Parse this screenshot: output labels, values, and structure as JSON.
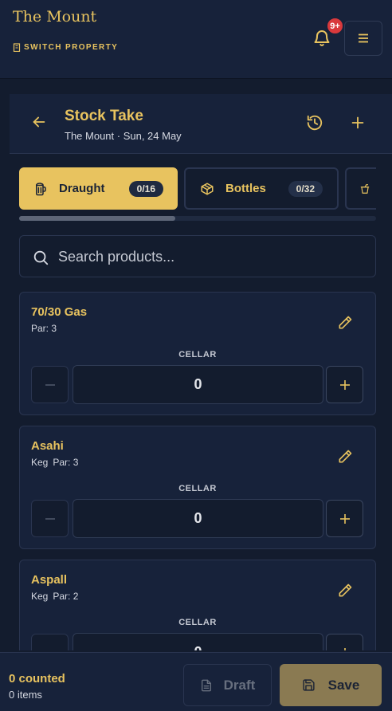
{
  "colors": {
    "accent": "#e8c35f",
    "background": "#131c2e",
    "panel": "#17223a",
    "badge": "#d9393c"
  },
  "header": {
    "brand": "The Mount",
    "switch_property": "SWITCH PROPERTY",
    "notification_badge": "9+"
  },
  "page": {
    "title": "Stock Take",
    "subtitle": "The Mount · Sun, 24 May"
  },
  "tabs": [
    {
      "label": "Draught",
      "count": "0/16",
      "icon": "beer-glass-icon",
      "active": true
    },
    {
      "label": "Bottles",
      "count": "0/32",
      "icon": "box-icon",
      "active": false
    },
    {
      "label": "",
      "count": "",
      "icon": "cup-icon",
      "active": false
    }
  ],
  "search": {
    "placeholder": "Search products...",
    "value": ""
  },
  "products": [
    {
      "name": "70/30 Gas",
      "unit": "",
      "par": "Par: 3",
      "location": "CELLAR",
      "value": "0"
    },
    {
      "name": "Asahi",
      "unit": "Keg",
      "par": "Par: 3",
      "location": "CELLAR",
      "value": "0"
    },
    {
      "name": "Aspall",
      "unit": "Keg",
      "par": "Par: 2",
      "location": "CELLAR",
      "value": "0"
    }
  ],
  "footer": {
    "counted": "0 counted",
    "items": "0 items",
    "draft_label": "Draft",
    "save_label": "Save"
  }
}
